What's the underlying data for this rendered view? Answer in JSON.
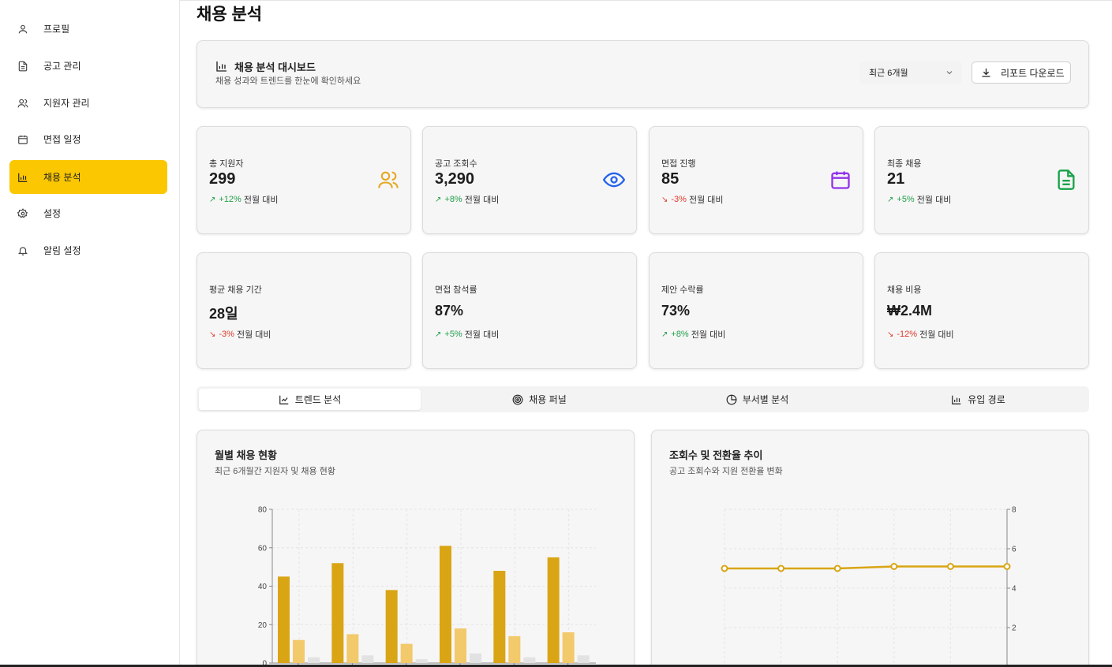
{
  "sidebar": {
    "items": [
      {
        "label": "프로필",
        "icon": "user-icon",
        "active": false
      },
      {
        "label": "공고 관리",
        "icon": "document-icon",
        "active": false
      },
      {
        "label": "지원자 관리",
        "icon": "users-icon",
        "active": false
      },
      {
        "label": "면접 일정",
        "icon": "calendar-icon",
        "active": false
      },
      {
        "label": "채용 분석",
        "icon": "bar-chart-icon",
        "active": true
      },
      {
        "label": "설정",
        "icon": "gear-icon",
        "active": false
      },
      {
        "label": "알림 설정",
        "icon": "bell-icon",
        "active": false
      }
    ]
  },
  "page": {
    "title": "채용 분석"
  },
  "header": {
    "title": "채용 분석 대시보드",
    "subtitle": "채용 성과와 트렌드를 한눈에 확인하세요",
    "period": "최근 6개월",
    "download_label": "리포트 다운로드"
  },
  "stats": [
    {
      "label": "총 지원자",
      "value": "299",
      "change": "+12%",
      "direction": "up",
      "suffix": "전월 대비",
      "icon": "users-icon",
      "color": "#e5a823"
    },
    {
      "label": "공고 조회수",
      "value": "3,290",
      "change": "+8%",
      "direction": "up",
      "suffix": "전월 대비",
      "icon": "eye-icon",
      "color": "#2563eb"
    },
    {
      "label": "면접 진행",
      "value": "85",
      "change": "-3%",
      "direction": "down",
      "suffix": "전월 대비",
      "icon": "calendar-icon",
      "color": "#9333ea"
    },
    {
      "label": "최종 채용",
      "value": "21",
      "change": "+5%",
      "direction": "up",
      "suffix": "전월 대비",
      "icon": "document-icon",
      "color": "#16a34a"
    },
    {
      "label": "평균 채용 기간",
      "value": "28일",
      "change": "-3%",
      "direction": "down",
      "suffix": "전월 대비"
    },
    {
      "label": "면접 참석률",
      "value": "87%",
      "change": "+5%",
      "direction": "up",
      "suffix": "전월 대비"
    },
    {
      "label": "제안 수락률",
      "value": "73%",
      "change": "+8%",
      "direction": "up",
      "suffix": "전월 대비"
    },
    {
      "label": "채용 비용",
      "value": "₩2.4M",
      "change": "-12%",
      "direction": "down",
      "suffix": "전월 대비"
    }
  ],
  "tabs": [
    {
      "label": "트렌드 분석",
      "icon": "trend-icon",
      "active": true
    },
    {
      "label": "채용 퍼널",
      "icon": "target-icon",
      "active": false
    },
    {
      "label": "부서별 분석",
      "icon": "pie-icon",
      "active": false
    },
    {
      "label": "유입 경로",
      "icon": "bar-chart-icon",
      "active": false
    }
  ],
  "charts": {
    "monthly": {
      "title": "월별 채용 현황",
      "subtitle": "최근 6개월간 지원자 및 채용 현황"
    },
    "views": {
      "title": "조회수 및 전환율 추이",
      "subtitle": "공고 조회수와 지원 전환율 변화"
    }
  },
  "chart_data": [
    {
      "type": "bar",
      "title": "월별 채용 현황",
      "ylim": [
        0,
        80
      ],
      "yticks": [
        0,
        20,
        40,
        60,
        80
      ],
      "categories": [
        "",
        "",
        "",
        "",
        "",
        ""
      ],
      "series": [
        {
          "values": [
            45,
            52,
            38,
            61,
            48,
            55
          ],
          "color": "#d9a514"
        },
        {
          "values": [
            12,
            15,
            10,
            18,
            14,
            16
          ],
          "color": "#f2c96b"
        },
        {
          "values": [
            3,
            4,
            2,
            5,
            3,
            4
          ],
          "color": "#e2e2e2"
        }
      ],
      "grid": true
    },
    {
      "type": "line",
      "title": "조회수 및 전환율 추이",
      "y2lim": [
        0,
        8
      ],
      "y2ticks": [
        2,
        4,
        6,
        8
      ],
      "series": [
        {
          "values": [
            5.0,
            5.0,
            5.0,
            5.1,
            5.1,
            5.1
          ],
          "color": "#d9a514",
          "axis": "right"
        }
      ],
      "grid": true
    }
  ]
}
